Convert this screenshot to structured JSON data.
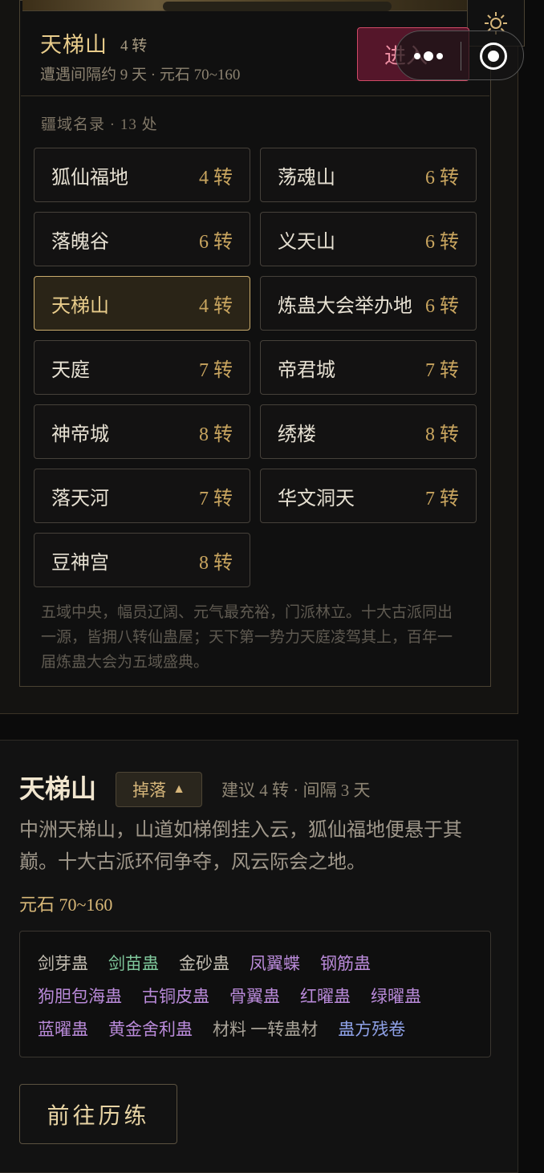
{
  "area": {
    "title": "天梯山",
    "tier": "4 转",
    "meta": "遭遇间隔约 9 天 · 元石 70~160",
    "enter_label": "进入"
  },
  "regions": {
    "heading": "疆域名录 · 13 处",
    "items": [
      {
        "name": "狐仙福地",
        "tier": "4 转"
      },
      {
        "name": "荡魂山",
        "tier": "6 转"
      },
      {
        "name": "落魄谷",
        "tier": "6 转"
      },
      {
        "name": "义天山",
        "tier": "6 转"
      },
      {
        "name": "天梯山",
        "tier": "4 转",
        "active": true
      },
      {
        "name": "炼蛊大会举办地",
        "tier": "6 转"
      },
      {
        "name": "天庭",
        "tier": "7 转"
      },
      {
        "name": "帝君城",
        "tier": "7 转"
      },
      {
        "name": "神帝城",
        "tier": "8 转"
      },
      {
        "name": "绣楼",
        "tier": "8 转"
      },
      {
        "name": "落天河",
        "tier": "7 转"
      },
      {
        "name": "华文洞天",
        "tier": "7 转"
      },
      {
        "name": "豆神宫",
        "tier": "8 转"
      }
    ],
    "description": "五域中央，幅员辽阔、元气最充裕，门派林立。十大古派同出一源，皆拥八转仙蛊屋；天下第一势力天庭凌驾其上，百年一届炼蛊大会为五域盛典。"
  },
  "detail": {
    "title": "天梯山",
    "drop_toggle_label": "掉落",
    "drop_toggle_icon": "▲",
    "meta": "建议 4 转 · 间隔 3 天",
    "description": "中洲天梯山，山道如梯倒挂入云，狐仙福地便悬于其巅。十大古派环伺争夺，风云际会之地。",
    "stone": "元石 70~160",
    "drops": [
      [
        {
          "name": "剑芽蛊",
          "color": "c-white"
        },
        {
          "name": "剑苗蛊",
          "color": "c-green"
        },
        {
          "name": "金砂蛊",
          "color": "c-white"
        },
        {
          "name": "凤翼蝶",
          "color": "c-purple"
        },
        {
          "name": "钢筋蛊",
          "color": "c-purple"
        }
      ],
      [
        {
          "name": "狗胆包海蛊",
          "color": "c-purple"
        },
        {
          "name": "古铜皮蛊",
          "color": "c-purple"
        },
        {
          "name": "骨翼蛊",
          "color": "c-purple"
        },
        {
          "name": "红曜蛊",
          "color": "c-purple"
        },
        {
          "name": "绿曜蛊",
          "color": "c-purple"
        }
      ],
      [
        {
          "name": "蓝曜蛊",
          "color": "c-purple"
        },
        {
          "name": "黄金舍利蛊",
          "color": "c-purple"
        },
        {
          "name": "材料 一转蛊材",
          "color": "c-gray"
        },
        {
          "name": "蛊方残卷",
          "color": "c-blue"
        }
      ]
    ],
    "go_label": "前往历练"
  },
  "icons": {
    "sun": "sun-icon",
    "more": "more-dots-icon",
    "record": "record-icon"
  }
}
